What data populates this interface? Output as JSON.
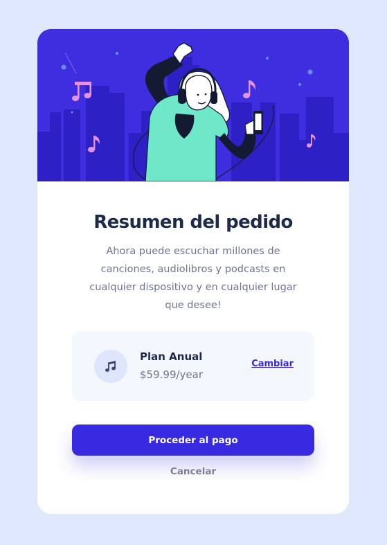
{
  "colors": {
    "page_background": "#e0e8fd",
    "card_background": "#ffffff",
    "hero_background": "#3e2ee0",
    "accent": "#382ae1",
    "title_text": "#1e2a4a",
    "muted_text": "#6e7391",
    "plan_box_background": "#f5f7ff",
    "character_shirt": "#6ee8c8",
    "music_notes": "#e493e6"
  },
  "hero": {
    "illustration": "person-dancing-with-headphones-and-phone",
    "icons": [
      "music-note-icon",
      "headphones-icon",
      "phone-icon"
    ]
  },
  "summary": {
    "title": "Resumen del pedido",
    "description": "Ahora puede escuchar millones de canciones, audiolibros y podcasts en cualquier dispositivo y en cualquier lugar que desee!"
  },
  "plan": {
    "icon": "music-note-icon",
    "name": "Plan Anual",
    "price": "$59.99/year",
    "change_label": "Cambiar"
  },
  "actions": {
    "pay_label": "Proceder al pago",
    "cancel_label": "Cancelar"
  }
}
